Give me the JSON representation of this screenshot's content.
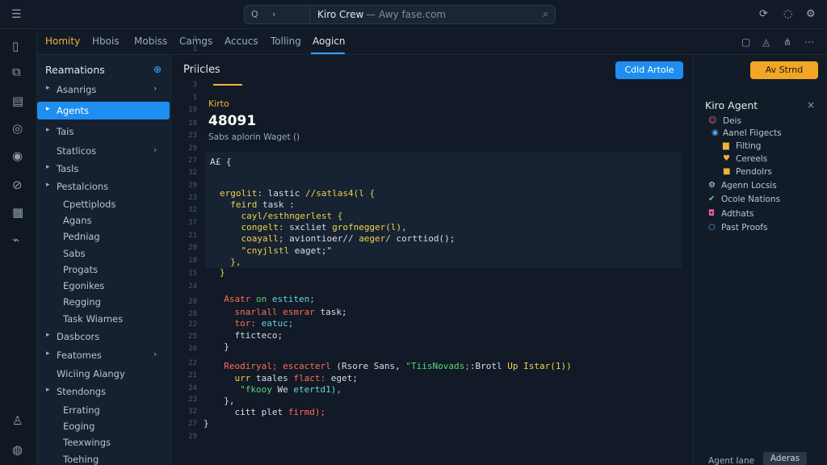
{
  "titlebar": {
    "menu_icon": "hamburger-icon",
    "search_left": "Q",
    "search_arrow": "›",
    "app_name": "Kiro Crew",
    "separator": "—",
    "url": "Awy fase.com",
    "right_icons": [
      "refresh-icon",
      "notification-icon",
      "settings-icon"
    ]
  },
  "tabs": [
    {
      "label": "Homity"
    },
    {
      "label": "Hbois"
    },
    {
      "label": "Mobiss"
    },
    {
      "label": "Camgs"
    },
    {
      "label": "Accucs"
    },
    {
      "label": "Tolling"
    },
    {
      "label": "Aogicn"
    }
  ],
  "sidebar": {
    "title": "Reamations",
    "items": [
      {
        "label": "Asanrigs",
        "arrow": "▸",
        "chev": "›"
      },
      {
        "label": "Agents",
        "arrow": "▸",
        "selected": true
      },
      {
        "label": "Tais",
        "arrow": "▸"
      },
      {
        "label": "Statlicos",
        "chev": "›"
      },
      {
        "label": "Tasls",
        "arrow": "▸"
      },
      {
        "label": "Pestalcions",
        "arrow": "▸"
      },
      {
        "label": "Cpettiplods"
      },
      {
        "label": "Agans"
      },
      {
        "label": "Pedniag"
      },
      {
        "label": "Sabs"
      },
      {
        "label": "Progats"
      },
      {
        "label": "Egonikes"
      },
      {
        "label": "Regging"
      },
      {
        "label": "Task Wiames"
      },
      {
        "label": "Dasbcors",
        "arrow": "▸"
      },
      {
        "label": "Featomes",
        "arrow": "▸",
        "chev": "›"
      },
      {
        "label": "Wiciing Aiangy"
      },
      {
        "label": "Stendongs",
        "arrow": "▸"
      },
      {
        "label": "Errating"
      },
      {
        "label": "Eoging"
      },
      {
        "label": "Teexwings"
      },
      {
        "label": "Toehing"
      }
    ]
  },
  "main": {
    "title": "Priicles",
    "primary_button": "Cdld Artole",
    "kicker": "Kirto",
    "big_number": "48091",
    "subtitle": "Sabs aplorin Waget ()",
    "line_numbers": [
      "2",
      "1",
      "4",
      "3",
      "1",
      "19",
      "18",
      "23",
      "29",
      "27",
      "32",
      "29",
      "23",
      "32",
      "37",
      "21",
      "20",
      "18",
      "15",
      "24",
      "20",
      "28",
      "22",
      "25",
      "26",
      "22",
      "21",
      "24",
      "23",
      "32",
      "27",
      "29"
    ],
    "code_lines": [
      [
        {
          "t": "A£ {",
          "c": "w"
        }
      ],
      [
        {
          "t": "ergolit: ",
          "c": "y"
        },
        {
          "t": "lastic ",
          "c": "w"
        },
        {
          "t": "//satlas4(l {",
          "c": "y"
        }
      ],
      [
        {
          "t": "  feird ",
          "c": "y"
        },
        {
          "t": "task :",
          "c": "w"
        }
      ],
      [
        {
          "t": "    cayl/esthngerlest {",
          "c": "y"
        }
      ],
      [
        {
          "t": "    congelt: ",
          "c": "y"
        },
        {
          "t": "sxcliet ",
          "c": "w"
        },
        {
          "t": "grofnegger(l),",
          "c": "y"
        }
      ],
      [
        {
          "t": "    coayall; ",
          "c": "y"
        },
        {
          "t": "aviontioer// ",
          "c": "w"
        },
        {
          "t": "aeger/ ",
          "c": "y"
        },
        {
          "t": "corttiod();",
          "c": "w"
        }
      ],
      [
        {
          "t": "    \"cnyjlstl ",
          "c": "y"
        },
        {
          "t": "eaget;\"",
          "c": "w"
        }
      ],
      [
        {
          "t": "  },",
          "c": "y"
        }
      ],
      [
        {
          "t": "}",
          "c": "y"
        }
      ],
      [
        {
          "t": "  Asatr ",
          "c": "r"
        },
        {
          "t": "on ",
          "c": "g"
        },
        {
          "t": "estiten;",
          "c": "c"
        }
      ],
      [
        {
          "t": "    snarlall ",
          "c": "r"
        },
        {
          "t": "esmrar ",
          "c": "r"
        },
        {
          "t": "task;",
          "c": "w"
        }
      ],
      [
        {
          "t": "    tor: ",
          "c": "r"
        },
        {
          "t": "eatuc;",
          "c": "c"
        }
      ],
      [
        {
          "t": "    fticteco;",
          "c": "w"
        }
      ],
      [
        {
          "t": "  }",
          "c": "w"
        }
      ],
      [
        {
          "t": "  Reodiryal; ",
          "c": "r"
        },
        {
          "t": "escacterl ",
          "c": "r"
        },
        {
          "t": "(Rsore Sans, ",
          "c": "w"
        },
        {
          "t": "\"TiisNovads;",
          "c": "g"
        },
        {
          "t": ":Brotl ",
          "c": "w"
        },
        {
          "t": "Up Istar(1))",
          "c": "y"
        }
      ],
      [
        {
          "t": "    urr ",
          "c": "y"
        },
        {
          "t": "taales ",
          "c": "w"
        },
        {
          "t": "flact: ",
          "c": "r"
        },
        {
          "t": "eget;",
          "c": "w"
        }
      ],
      [
        {
          "t": "     \"fkooy ",
          "c": "g"
        },
        {
          "t": "We ",
          "c": "w"
        },
        {
          "t": "etertd1),",
          "c": "c"
        }
      ],
      [
        {
          "t": "  },",
          "c": "w"
        }
      ],
      [
        {
          "t": "    citt ",
          "c": "w"
        },
        {
          "t": "plet ",
          "c": "w"
        },
        {
          "t": "firmd);",
          "c": "r"
        }
      ],
      [
        {
          "t": "}",
          "c": "w"
        }
      ]
    ]
  },
  "rightpanel": {
    "start_button": "Av Strnd",
    "title": "Kiro Agent",
    "close_icon": "close-icon",
    "items": [
      {
        "label": "Deis",
        "icon": "person-icon",
        "color": "#ff6a8a"
      },
      {
        "label": "Aanel Fiigects",
        "icon": "circle-dot-icon",
        "color": "#4aa8ff"
      },
      {
        "label": "Filting",
        "icon": "folder-icon",
        "color": "#f2b33a"
      },
      {
        "label": "Cereels",
        "icon": "heart-icon",
        "color": "#f2b33a"
      },
      {
        "label": "Pendolrs",
        "icon": "square-icon",
        "color": "#f2b33a"
      },
      {
        "label": "Agenn Locsis",
        "icon": "gear-icon",
        "color": "#d6dee8"
      },
      {
        "label": "Ocole Nations",
        "icon": "check-icon",
        "color": "#5cd67a"
      },
      {
        "label": "Adthats",
        "icon": "instagram-icon",
        "color": "#ff5aa0"
      },
      {
        "label": "Past Proofs",
        "icon": "ring-icon",
        "color": "#4aa8ff"
      }
    ],
    "bottom_text": "Agent Iane",
    "bottom_button": "Aderas"
  }
}
